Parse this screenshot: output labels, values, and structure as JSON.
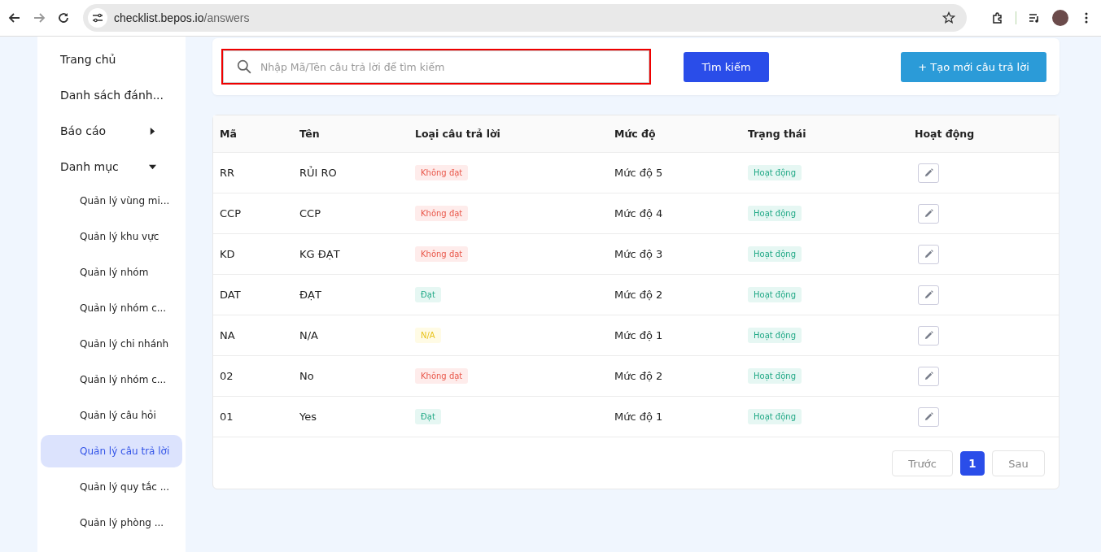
{
  "browser": {
    "url_host": "checklist.bepos.io",
    "url_path": "/answers"
  },
  "sidebar": {
    "items": [
      {
        "label": "Trang chủ",
        "kind": "link"
      },
      {
        "label": "Danh sách đánh...",
        "kind": "link"
      },
      {
        "label": "Báo cáo",
        "kind": "group",
        "expanded": false
      },
      {
        "label": "Danh mục",
        "kind": "group",
        "expanded": true,
        "children": [
          {
            "label": "Quản lý vùng mi...",
            "selected": false
          },
          {
            "label": "Quản lý khu vực",
            "selected": false
          },
          {
            "label": "Quản lý nhóm",
            "selected": false
          },
          {
            "label": "Quản lý nhóm c...",
            "selected": false
          },
          {
            "label": "Quản lý chi nhánh",
            "selected": false
          },
          {
            "label": "Quản lý nhóm c...",
            "selected": false
          },
          {
            "label": "Quản lý câu hỏi",
            "selected": false
          },
          {
            "label": "Quản lý câu trả lời",
            "selected": true
          },
          {
            "label": "Quản lý quy tắc ...",
            "selected": false
          },
          {
            "label": "Quản lý phòng ...",
            "selected": false
          }
        ]
      }
    ]
  },
  "search": {
    "placeholder": "Nhập Mã/Tên câu trả lời để tìm kiếm",
    "highlighted": true,
    "button": "Tìm kiếm",
    "create_button": "+ Tạo mới câu trả lời"
  },
  "table": {
    "columns": [
      "Mã",
      "Tên",
      "Loại câu trả lời",
      "Mức độ",
      "Trạng thái",
      "Hoạt động"
    ],
    "rows": [
      {
        "code": "RR",
        "name": "RỦI RO",
        "type": {
          "label": "Không đạt",
          "kind": "fail"
        },
        "level": "Mức độ 5",
        "status": {
          "label": "Hoạt động",
          "kind": "active"
        }
      },
      {
        "code": "CCP",
        "name": "CCP",
        "type": {
          "label": "Không đạt",
          "kind": "fail"
        },
        "level": "Mức độ 4",
        "status": {
          "label": "Hoạt động",
          "kind": "active"
        }
      },
      {
        "code": "KD",
        "name": "KG ĐẠT",
        "type": {
          "label": "Không đạt",
          "kind": "fail"
        },
        "level": "Mức độ 3",
        "status": {
          "label": "Hoạt động",
          "kind": "active"
        }
      },
      {
        "code": "DAT",
        "name": "ĐẠT",
        "type": {
          "label": "Đạt",
          "kind": "pass"
        },
        "level": "Mức độ 2",
        "status": {
          "label": "Hoạt động",
          "kind": "active"
        }
      },
      {
        "code": "NA",
        "name": "N/A",
        "type": {
          "label": "N/A",
          "kind": "na"
        },
        "level": "Mức độ 1",
        "status": {
          "label": "Hoạt động",
          "kind": "active"
        }
      },
      {
        "code": "02",
        "name": "No",
        "type": {
          "label": "Không đạt",
          "kind": "fail"
        },
        "level": "Mức độ 2",
        "status": {
          "label": "Hoạt động",
          "kind": "active"
        }
      },
      {
        "code": "01",
        "name": "Yes",
        "type": {
          "label": "Đạt",
          "kind": "pass"
        },
        "level": "Mức độ 1",
        "status": {
          "label": "Hoạt động",
          "kind": "active"
        }
      }
    ]
  },
  "pagination": {
    "prev": "Trước",
    "pages": [
      {
        "label": "1",
        "selected": true
      }
    ],
    "next": "Sau"
  }
}
